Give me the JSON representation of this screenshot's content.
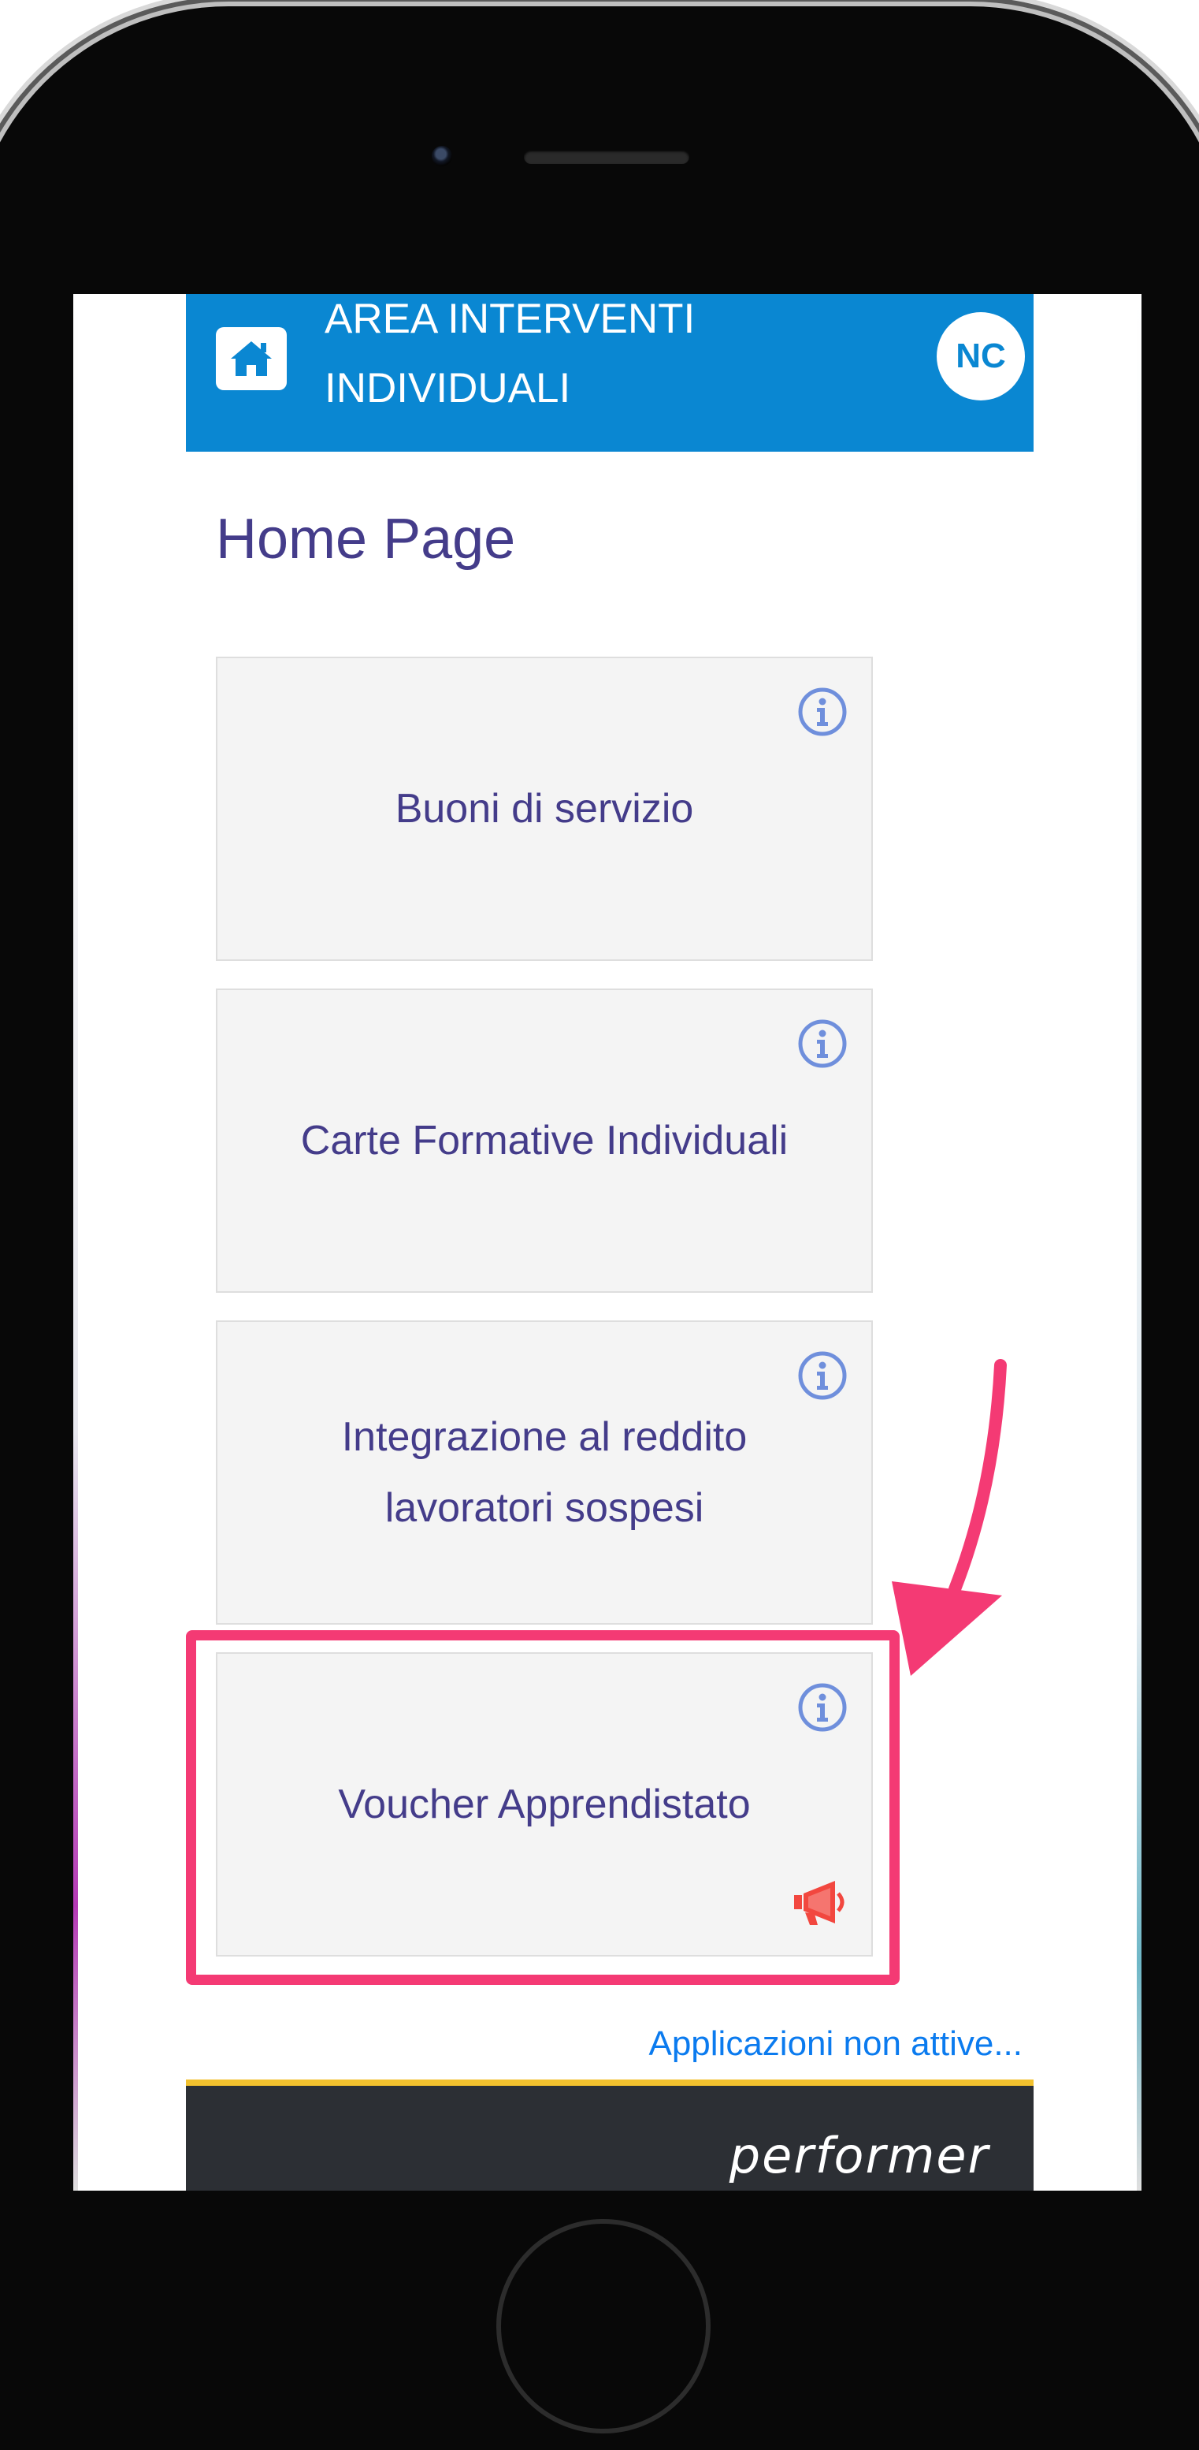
{
  "header": {
    "title": "AREA INTERVENTI INDIVIDUALI",
    "home_icon": "home-icon",
    "user_initials": "NC"
  },
  "page": {
    "title": "Home Page"
  },
  "cards": [
    {
      "label": "Buoni di servizio",
      "icon": "info-icon"
    },
    {
      "label": "Carte Formative Individuali",
      "icon": "info-icon"
    },
    {
      "label": "Integrazione al reddito lavoratori sospesi",
      "icon": "info-icon"
    },
    {
      "label": "Voucher Apprendistato",
      "icon": "info-icon",
      "badge_icon": "megaphone-icon",
      "highlighted": true
    }
  ],
  "footer": {
    "inactive_link": "Applicazioni non attive...",
    "brand": "performer"
  },
  "colors": {
    "header_bg": "#0a87d2",
    "title_text": "#443c8a",
    "card_bg": "#f4f4f4",
    "info_icon": "#6f8fdc",
    "megaphone": "#f2473f",
    "highlight": "#f43a74",
    "link": "#0b7bef",
    "footer_bg": "#2c2f34",
    "footer_border": "#f2c12e"
  }
}
